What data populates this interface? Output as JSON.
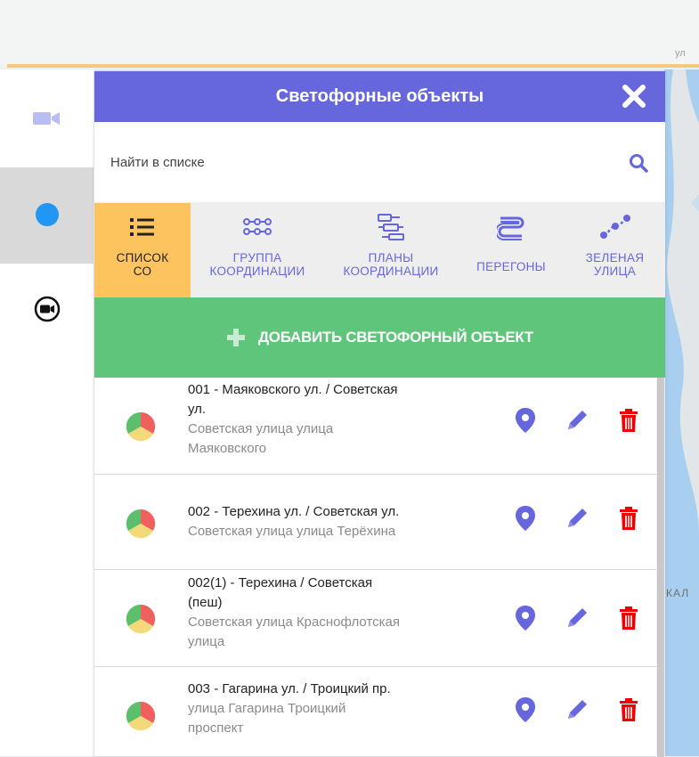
{
  "map": {
    "label_fragment": "КАЛ",
    "hint": "ул"
  },
  "panel": {
    "title": "Светофорные объекты",
    "search": {
      "placeholder": "Найти в списке"
    },
    "tabs": [
      {
        "line1": "СПИСОК",
        "line2": "СО",
        "icon": "list-icon",
        "active": true
      },
      {
        "line1": "ГРУППА",
        "line2": "КООРДИНАЦИИ",
        "icon": "group-icon",
        "active": false
      },
      {
        "line1": "ПЛАНЫ",
        "line2": "КООРДИНАЦИИ",
        "icon": "plans-icon",
        "active": false
      },
      {
        "line1": "ПЕРЕГОНЫ",
        "line2": "",
        "icon": "route-icon",
        "active": false
      },
      {
        "line1": "ЗЕЛЕНАЯ",
        "line2": "УЛИЦА",
        "icon": "green-street-icon",
        "active": false
      }
    ],
    "add_button": "ДОБАВИТЬ СВЕТОФОРНЫЙ ОБЪЕКТ",
    "items": [
      {
        "title_line1": "001 - Маяковского ул. / Советская",
        "title_line2": "ул.",
        "sub_line1": "Советская улица улица",
        "sub_line2": "Маяковского"
      },
      {
        "title_line1": "002 - Терехина ул. / Советская ул.",
        "title_line2": "",
        "sub_line1": "Советская улица улица Терёхина",
        "sub_line2": ""
      },
      {
        "title_line1": "002(1) - Терехина / Советская",
        "title_line2": "(пеш)",
        "sub_line1": "Советская улица Краснофлотская",
        "sub_line2": "улица"
      },
      {
        "title_line1": "003 - Гагарина ул. / Троицкий пр.",
        "title_line2": "",
        "sub_line1": "улица Гагарина Троицкий",
        "sub_line2": "проспект"
      }
    ]
  },
  "colors": {
    "accent": "#6667dd",
    "active_tab": "#fdc35f",
    "add": "#5ec57a",
    "delete": "#f00000",
    "pie_red": "#f0605e",
    "pie_green": "#5cbf6b",
    "pie_yellow": "#f3d97a"
  }
}
